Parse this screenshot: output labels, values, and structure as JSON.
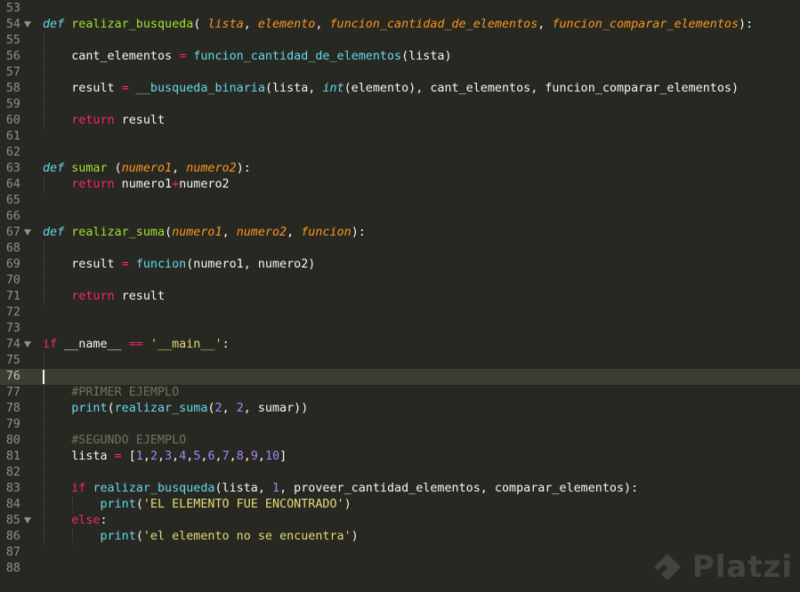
{
  "editor": {
    "current_line": 76,
    "lines": [
      {
        "n": 53,
        "fold": false,
        "tokens": []
      },
      {
        "n": 54,
        "fold": true,
        "tokens": [
          [
            "def",
            "def"
          ],
          [
            "pl",
            " "
          ],
          [
            "fn",
            "realizar_busqueda"
          ],
          [
            "pl",
            "( "
          ],
          [
            "prm",
            "lista"
          ],
          [
            "pl",
            ", "
          ],
          [
            "prm",
            "elemento"
          ],
          [
            "pl",
            ", "
          ],
          [
            "prm",
            "funcion_cantidad_de_elementos"
          ],
          [
            "pl",
            ", "
          ],
          [
            "prm",
            "funcion_comparar_elementos"
          ],
          [
            "pl",
            "):"
          ]
        ]
      },
      {
        "n": 55,
        "fold": false,
        "tokens": []
      },
      {
        "n": 56,
        "fold": false,
        "tokens": [
          [
            "pl",
            "    cant_elementos "
          ],
          [
            "op",
            "="
          ],
          [
            "pl",
            " "
          ],
          [
            "bi",
            "funcion_cantidad_de_elementos"
          ],
          [
            "pl",
            "(lista)"
          ]
        ]
      },
      {
        "n": 57,
        "fold": false,
        "tokens": []
      },
      {
        "n": 58,
        "fold": false,
        "tokens": [
          [
            "pl",
            "    result "
          ],
          [
            "op",
            "="
          ],
          [
            "pl",
            " "
          ],
          [
            "bi",
            "__busqueda_binaria"
          ],
          [
            "pl",
            "(lista, "
          ],
          [
            "bit",
            "int"
          ],
          [
            "pl",
            "(elemento), cant_elementos, funcion_comparar_elementos)"
          ]
        ]
      },
      {
        "n": 59,
        "fold": false,
        "tokens": []
      },
      {
        "n": 60,
        "fold": false,
        "tokens": [
          [
            "pl",
            "    "
          ],
          [
            "kw",
            "return"
          ],
          [
            "pl",
            " result"
          ]
        ]
      },
      {
        "n": 61,
        "fold": false,
        "tokens": []
      },
      {
        "n": 62,
        "fold": false,
        "tokens": []
      },
      {
        "n": 63,
        "fold": false,
        "tokens": [
          [
            "def",
            "def"
          ],
          [
            "pl",
            " "
          ],
          [
            "fn",
            "sumar"
          ],
          [
            "pl",
            " ("
          ],
          [
            "prm",
            "numero1"
          ],
          [
            "pl",
            ", "
          ],
          [
            "prm",
            "numero2"
          ],
          [
            "pl",
            "):"
          ]
        ]
      },
      {
        "n": 64,
        "fold": false,
        "tokens": [
          [
            "pl",
            "    "
          ],
          [
            "kw",
            "return"
          ],
          [
            "pl",
            " numero1"
          ],
          [
            "op",
            "+"
          ],
          [
            "pl",
            "numero2"
          ]
        ]
      },
      {
        "n": 65,
        "fold": false,
        "tokens": []
      },
      {
        "n": 66,
        "fold": false,
        "tokens": []
      },
      {
        "n": 67,
        "fold": true,
        "tokens": [
          [
            "def",
            "def"
          ],
          [
            "pl",
            " "
          ],
          [
            "fn",
            "realizar_suma"
          ],
          [
            "pl",
            "("
          ],
          [
            "prm",
            "numero1"
          ],
          [
            "pl",
            ", "
          ],
          [
            "prm",
            "numero2"
          ],
          [
            "pl",
            ", "
          ],
          [
            "prm",
            "funcion"
          ],
          [
            "pl",
            "):"
          ]
        ]
      },
      {
        "n": 68,
        "fold": false,
        "tokens": []
      },
      {
        "n": 69,
        "fold": false,
        "tokens": [
          [
            "pl",
            "    result "
          ],
          [
            "op",
            "="
          ],
          [
            "pl",
            " "
          ],
          [
            "bi",
            "funcion"
          ],
          [
            "pl",
            "(numero1, numero2)"
          ]
        ]
      },
      {
        "n": 70,
        "fold": false,
        "tokens": []
      },
      {
        "n": 71,
        "fold": false,
        "tokens": [
          [
            "pl",
            "    "
          ],
          [
            "kw",
            "return"
          ],
          [
            "pl",
            " result"
          ]
        ]
      },
      {
        "n": 72,
        "fold": false,
        "tokens": []
      },
      {
        "n": 73,
        "fold": false,
        "tokens": []
      },
      {
        "n": 74,
        "fold": true,
        "tokens": [
          [
            "kw",
            "if"
          ],
          [
            "pl",
            " __name__ "
          ],
          [
            "op",
            "=="
          ],
          [
            "pl",
            " "
          ],
          [
            "str",
            "'__main__'"
          ],
          [
            "pl",
            ":"
          ]
        ]
      },
      {
        "n": 75,
        "fold": false,
        "tokens": []
      },
      {
        "n": 76,
        "fold": false,
        "tokens": []
      },
      {
        "n": 77,
        "fold": false,
        "tokens": [
          [
            "pl",
            "    "
          ],
          [
            "cmt",
            "#PRIMER EJEMPLO"
          ]
        ]
      },
      {
        "n": 78,
        "fold": false,
        "tokens": [
          [
            "pl",
            "    "
          ],
          [
            "bi",
            "print"
          ],
          [
            "pl",
            "("
          ],
          [
            "bi",
            "realizar_suma"
          ],
          [
            "pl",
            "("
          ],
          [
            "num",
            "2"
          ],
          [
            "pl",
            ", "
          ],
          [
            "num",
            "2"
          ],
          [
            "pl",
            ", sumar))"
          ]
        ]
      },
      {
        "n": 79,
        "fold": false,
        "tokens": []
      },
      {
        "n": 80,
        "fold": false,
        "tokens": [
          [
            "pl",
            "    "
          ],
          [
            "cmt",
            "#SEGUNDO EJEMPLO"
          ]
        ]
      },
      {
        "n": 81,
        "fold": false,
        "tokens": [
          [
            "pl",
            "    lista "
          ],
          [
            "op",
            "="
          ],
          [
            "pl",
            " ["
          ],
          [
            "num",
            "1"
          ],
          [
            "pl",
            ","
          ],
          [
            "num",
            "2"
          ],
          [
            "pl",
            ","
          ],
          [
            "num",
            "3"
          ],
          [
            "pl",
            ","
          ],
          [
            "num",
            "4"
          ],
          [
            "pl",
            ","
          ],
          [
            "num",
            "5"
          ],
          [
            "pl",
            ","
          ],
          [
            "num",
            "6"
          ],
          [
            "pl",
            ","
          ],
          [
            "num",
            "7"
          ],
          [
            "pl",
            ","
          ],
          [
            "num",
            "8"
          ],
          [
            "pl",
            ","
          ],
          [
            "num",
            "9"
          ],
          [
            "pl",
            ","
          ],
          [
            "num",
            "10"
          ],
          [
            "pl",
            "]"
          ]
        ]
      },
      {
        "n": 82,
        "fold": false,
        "tokens": []
      },
      {
        "n": 83,
        "fold": false,
        "tokens": [
          [
            "pl",
            "    "
          ],
          [
            "kw",
            "if"
          ],
          [
            "pl",
            " "
          ],
          [
            "bi",
            "realizar_busqueda"
          ],
          [
            "pl",
            "(lista, "
          ],
          [
            "num",
            "1"
          ],
          [
            "pl",
            ", proveer_cantidad_elementos, comparar_elementos):"
          ]
        ]
      },
      {
        "n": 84,
        "fold": false,
        "tokens": [
          [
            "pl",
            "        "
          ],
          [
            "bi",
            "print"
          ],
          [
            "pl",
            "("
          ],
          [
            "str",
            "'EL ELEMENTO FUE ENCONTRADO'"
          ],
          [
            "pl",
            ")"
          ]
        ]
      },
      {
        "n": 85,
        "fold": true,
        "tokens": [
          [
            "pl",
            "    "
          ],
          [
            "kw",
            "else"
          ],
          [
            "pl",
            ":"
          ]
        ]
      },
      {
        "n": 86,
        "fold": false,
        "tokens": [
          [
            "pl",
            "        "
          ],
          [
            "bi",
            "print"
          ],
          [
            "pl",
            "("
          ],
          [
            "str",
            "'el elemento no se encuentra'"
          ],
          [
            "pl",
            ")"
          ]
        ]
      },
      {
        "n": 87,
        "fold": false,
        "tokens": []
      },
      {
        "n": 88,
        "fold": false,
        "tokens": []
      }
    ]
  },
  "watermark": {
    "text": "Platzi",
    "icon": "platzi-logo-icon"
  }
}
